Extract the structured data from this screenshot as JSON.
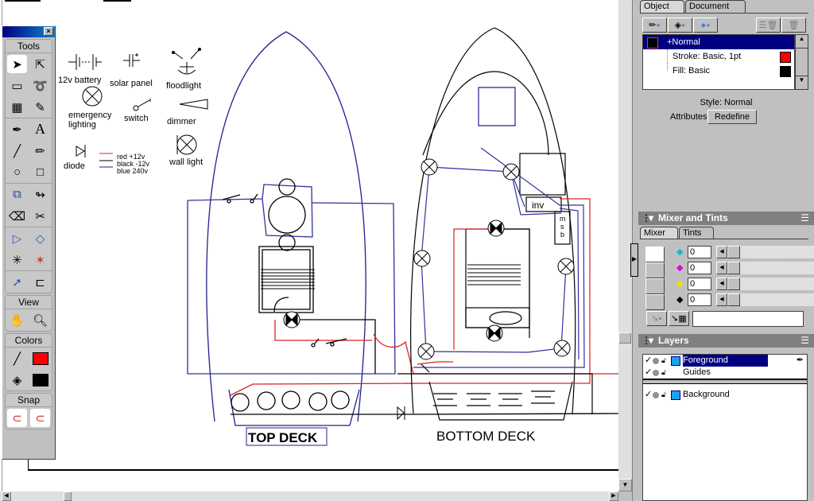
{
  "tools_palette": {
    "title": "Tools",
    "sections": [
      {
        "name": "tools",
        "tools": [
          "pointer",
          "subselect",
          "scale",
          "freeform",
          "trace",
          "eyedropper",
          "pen",
          "text",
          "line",
          "pencil",
          "ellipse",
          "rectangle",
          "reflect",
          "lasso",
          "eraser",
          "knife",
          "extrude",
          "3d-rotate",
          "graphic-hose",
          "mirror",
          "hyperlink",
          "link"
        ]
      },
      {
        "name": "view",
        "label": "View",
        "tools": [
          "hand",
          "zoom"
        ]
      },
      {
        "name": "colors",
        "label": "Colors",
        "stroke_color": "#ff0000",
        "fill_color": "#000000"
      },
      {
        "name": "snap",
        "label": "Snap"
      }
    ]
  },
  "legend": {
    "battery": "12v battery",
    "solar_panel": "solar panel",
    "floodlight": "floodlight",
    "emergency_lighting_1": "emergency",
    "emergency_lighting_2": "lighting",
    "switch": "switch",
    "dimmer": "dimmer",
    "diode": "diode",
    "wall_light": "wall light",
    "wire_red": "red +12v",
    "wire_black": "black -12v",
    "wire_blue": "blue 240v",
    "colors": {
      "red": "#e02020",
      "black": "#000000",
      "blue": "#202090"
    }
  },
  "diagram": {
    "top_deck_label": "TOP DECK",
    "bottom_deck_label": "BOTTOM DECK",
    "inverter_label": "inv",
    "msb_label": [
      "m",
      "s",
      "b"
    ]
  },
  "object_panel": {
    "tabs": [
      "Object",
      "Document"
    ],
    "active_tab": "Object",
    "items": [
      {
        "label": "+Normal",
        "swatch": "#000000",
        "selected": true
      },
      {
        "label": "Stroke: Basic, 1pt",
        "swatch": "#ff0000"
      },
      {
        "label": "Fill: Basic",
        "swatch": "#000000"
      }
    ],
    "style_label": "Style: Normal",
    "attributes_label": "Attributes:",
    "redefine_label": "Redefine"
  },
  "mixer_panel": {
    "title": "Mixer and Tints",
    "tabs": [
      "Mixer",
      "Tints"
    ],
    "active_tab": "Mixer",
    "channels": [
      {
        "name": "cyan",
        "color": "#00e0e0",
        "value": "0"
      },
      {
        "name": "magenta",
        "color": "#e000e0",
        "value": "0"
      },
      {
        "name": "yellow",
        "color": "#f0f000",
        "value": "0"
      },
      {
        "name": "black",
        "color": "#000000",
        "value": "0"
      }
    ],
    "hex_field": ""
  },
  "layers_panel": {
    "title": "Layers",
    "layers": [
      {
        "name": "Foreground",
        "selected": true,
        "has_color": true
      },
      {
        "name": "Guides",
        "selected": false,
        "has_color": false
      },
      {
        "name": "Background",
        "selected": false,
        "has_color": true
      }
    ]
  }
}
